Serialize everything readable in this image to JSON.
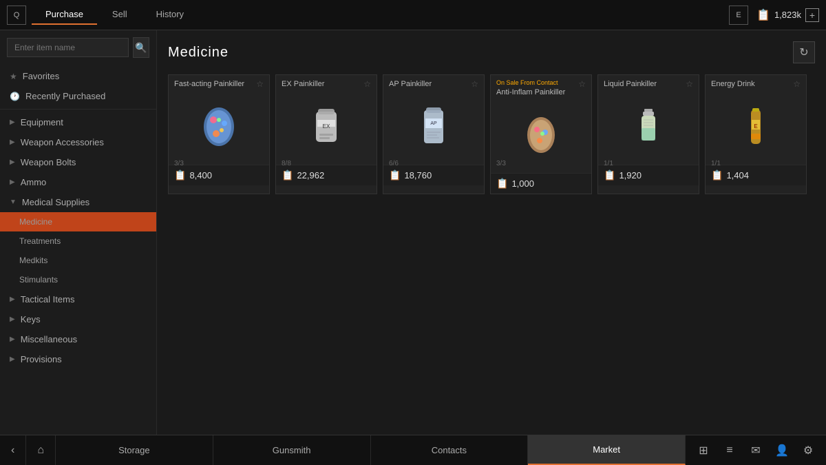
{
  "topbar": {
    "left_badge": "Q",
    "right_badge": "E",
    "tabs": [
      {
        "label": "Purchase",
        "active": true
      },
      {
        "label": "Sell",
        "active": false
      },
      {
        "label": "History",
        "active": false
      }
    ],
    "currency": "1,823k",
    "currency_icon": "📋",
    "plus_label": "+"
  },
  "search": {
    "placeholder": "Enter item name"
  },
  "sidebar": {
    "items": [
      {
        "id": "favorites",
        "label": "Favorites",
        "icon": "★",
        "type": "top"
      },
      {
        "id": "recently-purchased",
        "label": "Recently Purchased",
        "icon": "🕐",
        "type": "top"
      },
      {
        "id": "equipment",
        "label": "Equipment",
        "icon": "▶",
        "type": "category"
      },
      {
        "id": "weapon-accessories",
        "label": "Weapon Accessories",
        "icon": "▶",
        "type": "category"
      },
      {
        "id": "weapon-bolts",
        "label": "Weapon Bolts",
        "icon": "▶",
        "type": "category"
      },
      {
        "id": "ammo",
        "label": "Ammo",
        "icon": "▶",
        "type": "category"
      },
      {
        "id": "medical-supplies",
        "label": "Medical Supplies",
        "icon": "▼",
        "type": "category",
        "expanded": true
      },
      {
        "id": "medicine",
        "label": "Medicine",
        "type": "sub",
        "active": true
      },
      {
        "id": "treatments",
        "label": "Treatments",
        "type": "sub"
      },
      {
        "id": "medkits",
        "label": "Medkits",
        "type": "sub"
      },
      {
        "id": "stimulants",
        "label": "Stimulants",
        "type": "sub"
      },
      {
        "id": "tactical-items",
        "label": "Tactical Items",
        "icon": "▶",
        "type": "category"
      },
      {
        "id": "keys",
        "label": "Keys",
        "icon": "▶",
        "type": "category"
      },
      {
        "id": "miscellaneous",
        "label": "Miscellaneous",
        "icon": "▶",
        "type": "category"
      },
      {
        "id": "provisions",
        "label": "Provisions",
        "icon": "▶",
        "type": "category"
      }
    ]
  },
  "content": {
    "title": "Medicine",
    "items": [
      {
        "id": "fast-acting-painkiller",
        "name": "Fast-acting Painkiller",
        "stock": "3/3",
        "price": "8,400",
        "on_sale": false,
        "sale_text": ""
      },
      {
        "id": "ex-painkiller",
        "name": "EX Painkiller",
        "stock": "8/8",
        "price": "22,962",
        "on_sale": false,
        "sale_text": ""
      },
      {
        "id": "ap-painkiller",
        "name": "AP Painkiller",
        "stock": "6/6",
        "price": "18,760",
        "on_sale": false,
        "sale_text": ""
      },
      {
        "id": "anti-inflam-painkiller",
        "name": "Anti-Inflam Painkiller",
        "stock": "3/3",
        "price": "1,000",
        "on_sale": true,
        "sale_text": "On Sale From Contact"
      },
      {
        "id": "liquid-painkiller",
        "name": "Liquid Painkiller",
        "stock": "1/1",
        "price": "1,920",
        "on_sale": false,
        "sale_text": ""
      },
      {
        "id": "energy-drink",
        "name": "Energy Drink",
        "stock": "1/1",
        "price": "1,404",
        "on_sale": false,
        "sale_text": ""
      }
    ]
  },
  "bottombar": {
    "tabs": [
      {
        "label": "Storage",
        "active": false
      },
      {
        "label": "Gunsmith",
        "active": false
      },
      {
        "label": "Contacts",
        "active": false
      },
      {
        "label": "Market",
        "active": true
      }
    ],
    "icons": [
      {
        "id": "grid-icon",
        "symbol": "⊞"
      },
      {
        "id": "list-icon",
        "symbol": "≡"
      },
      {
        "id": "mail-icon",
        "symbol": "✉"
      },
      {
        "id": "person-icon",
        "symbol": "👤"
      },
      {
        "id": "settings-icon",
        "symbol": "⚙"
      }
    ]
  }
}
